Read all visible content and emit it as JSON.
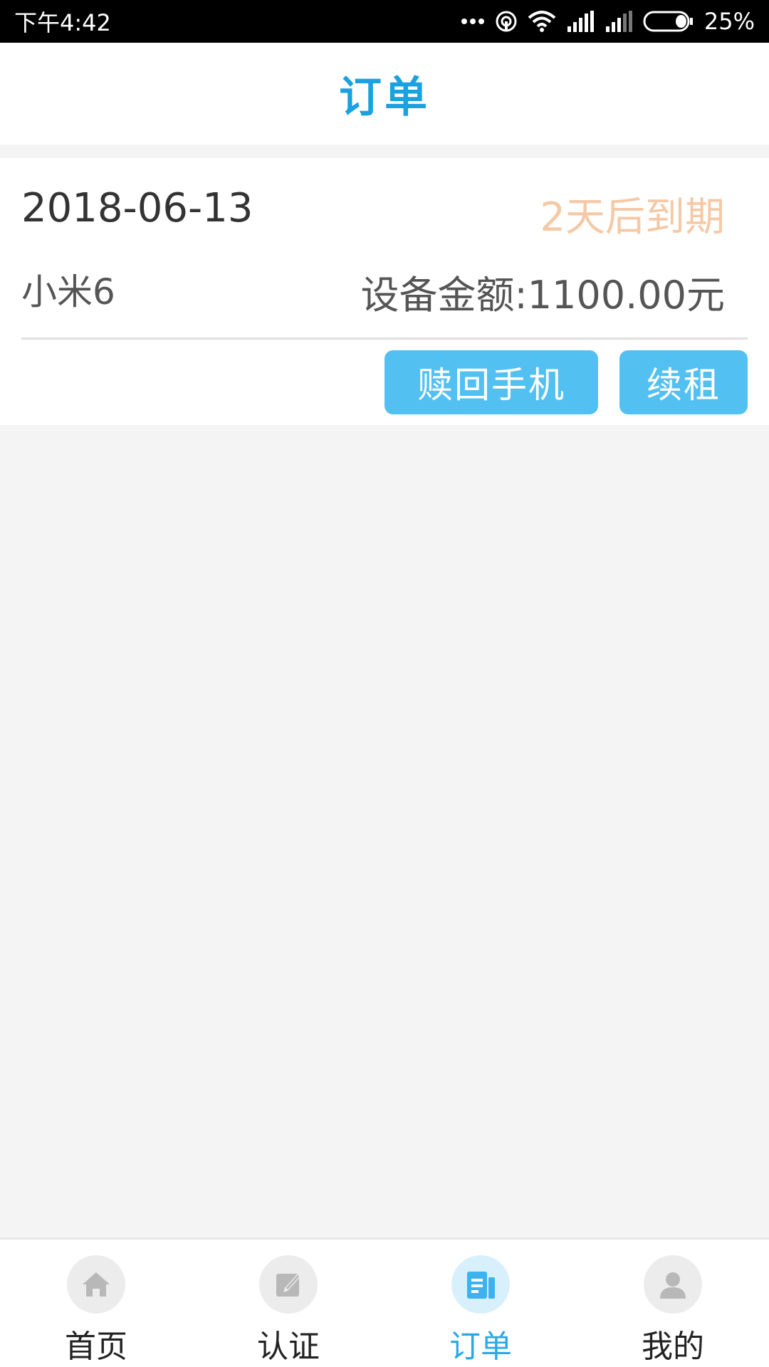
{
  "status_bar": {
    "time": "下午4:42",
    "battery": "25%"
  },
  "header": {
    "title": "订单"
  },
  "order": {
    "date": "2018-06-13",
    "expiry": "2天后到期",
    "device": "小米6",
    "amount": "设备金额:1100.00元",
    "redeem_label": "赎回手机",
    "renew_label": "续租"
  },
  "nav": {
    "items": [
      {
        "label": "首页",
        "icon": "home-icon"
      },
      {
        "label": "认证",
        "icon": "edit-icon"
      },
      {
        "label": "订单",
        "icon": "orders-icon",
        "active": true
      },
      {
        "label": "我的",
        "icon": "user-icon"
      }
    ]
  },
  "colors": {
    "accent": "#1aa1e0",
    "button": "#53c0f2",
    "expiry": "#f6c9a6",
    "background": "#f4f4f4"
  }
}
